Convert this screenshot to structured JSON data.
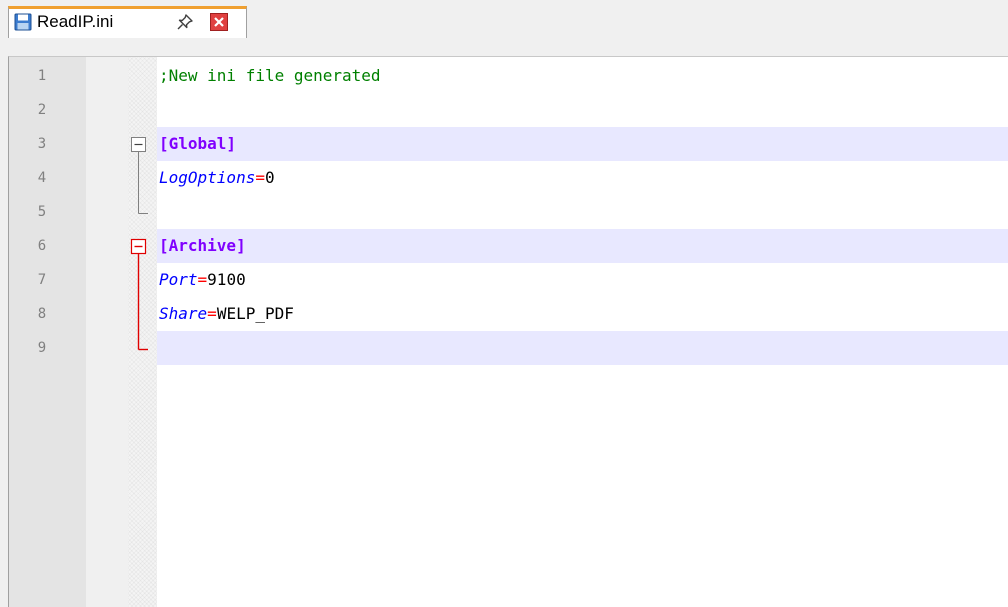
{
  "tab": {
    "filename": "ReadIP.ini",
    "save_icon": "floppy-disk-icon",
    "pin_icon": "pin-icon",
    "close_icon": "close-icon"
  },
  "editor": {
    "lines": [
      {
        "num": "1",
        "comment": ";New ini file generated"
      },
      {
        "num": "2"
      },
      {
        "num": "3",
        "section": "[Global]"
      },
      {
        "num": "4",
        "key": "LogOptions",
        "eq": "=",
        "value": "0"
      },
      {
        "num": "5"
      },
      {
        "num": "6",
        "section": "[Archive]"
      },
      {
        "num": "7",
        "key": "Port",
        "eq": "=",
        "value": "9100"
      },
      {
        "num": "8",
        "key": "Share",
        "eq": "=",
        "value": "WELP_PDF"
      },
      {
        "num": "9"
      }
    ]
  },
  "colors": {
    "tab_accent": "#f0a030",
    "close_icon_red": "#e04040",
    "fold_active_red": "#e00000",
    "fold_inactive": "#808080",
    "section_purple": "#8000ff",
    "key_blue": "#0000ff",
    "comment_green": "#008000",
    "highlight_row": "#e8e8ff"
  }
}
